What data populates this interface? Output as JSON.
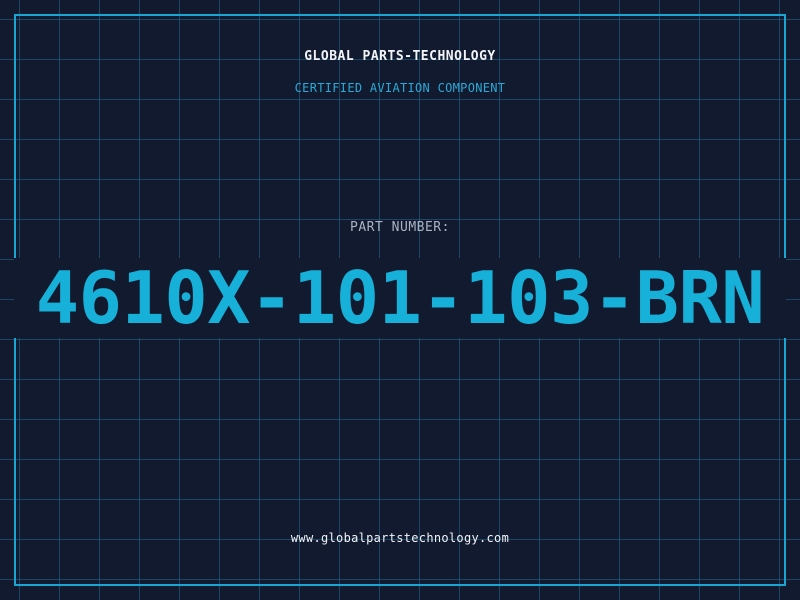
{
  "header": {
    "company": "GLOBAL PARTS-TECHNOLOGY",
    "subtitle": "CERTIFIED AVIATION COMPONENT"
  },
  "part": {
    "label": "PART NUMBER:",
    "number": "4610X-101-103-BRN"
  },
  "footer": {
    "website": "www.globalpartstechnology.com"
  },
  "colors": {
    "background": "#111a2e",
    "grid": "#246991",
    "accent": "#17b0d8",
    "text": "#f2f4f8",
    "muted": "#a9b3c2"
  }
}
